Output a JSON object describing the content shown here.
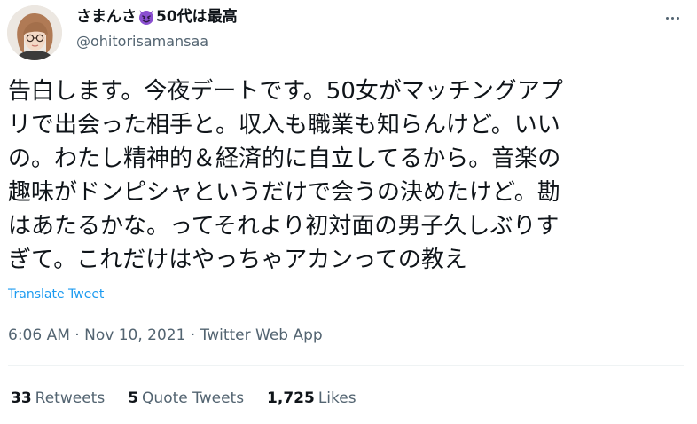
{
  "user": {
    "display_name_prefix": "さまんさ",
    "display_name_suffix": "50代は最高",
    "handle": "@ohitorisamansaa",
    "emoji_icon": "smiling-devil-emoji",
    "accent_color": "#8a4fd0"
  },
  "tweet": {
    "lines": [
      "告白します。今夜デートです。50女がマッチングアプ",
      "リで出会った相手と。収入も職業も知らんけど。いい",
      "の。わたし精神的＆経済的に自立してるから。音楽の",
      "趣味がドンピシャというだけで会うの決めたけど。勘",
      "はあたるかな。ってそれより初対面の男子久しぶりす",
      "ぎて。これだけはやっちゃアカンっての教え"
    ],
    "translate_label": "Translate Tweet"
  },
  "meta": {
    "time": "6:06 AM",
    "sep1": " · ",
    "date": "Nov 10, 2021",
    "sep2": " · ",
    "source": "Twitter Web App"
  },
  "stats": {
    "retweets_count": "33",
    "retweets_label": "Retweets",
    "quote_count": "5",
    "quote_label": "Quote Tweets",
    "likes_count": "1,725",
    "likes_label": "Likes"
  },
  "colors": {
    "text": "#0f1419",
    "secondary": "#536471",
    "link": "#1d9bf0",
    "divider": "#eff3f4"
  }
}
